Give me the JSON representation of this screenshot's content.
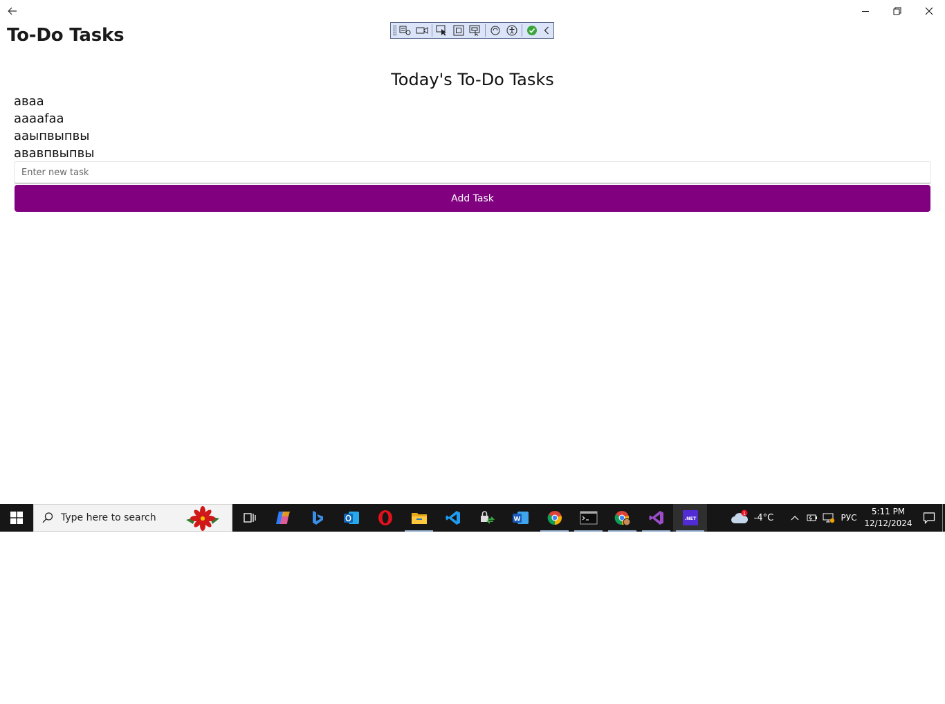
{
  "window": {
    "title": "To-Do Tasks"
  },
  "page": {
    "heading": "Today's To-Do Tasks",
    "tasks": [
      "аваа",
      "ааааfaa",
      "ааыпвыпвы",
      "ававпвыпвы"
    ],
    "input_placeholder": "Enter new task",
    "input_value": "",
    "add_button_label": "Add Task",
    "accent_color": "#800080"
  },
  "taskbar": {
    "search_placeholder": "Type here to search",
    "weather_temp": "-4°C",
    "weather_badge": "1",
    "language": "РУС",
    "time": "5:11 PM",
    "date": "12/12/2024",
    "pinned_apps": [
      "task-view",
      "copilot",
      "bing",
      "outlook",
      "opera",
      "file-explorer",
      "vscode",
      "security-app",
      "word",
      "chrome",
      "terminal",
      "chrome-profile",
      "visual-studio",
      "dotnet"
    ]
  }
}
